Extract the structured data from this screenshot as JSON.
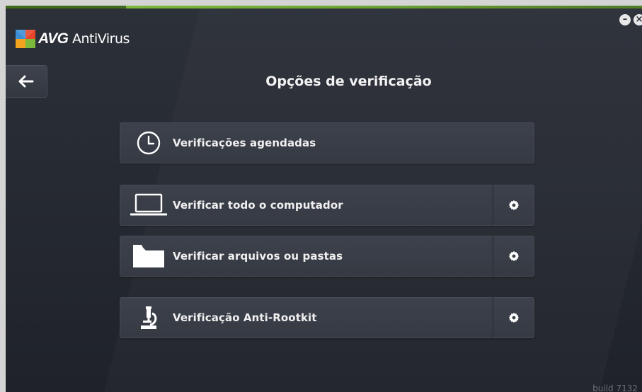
{
  "app": {
    "brand": "AVG",
    "product": "AntiVirus",
    "build_text": "build 7132"
  },
  "window_controls": {
    "minimize_symbol": "–",
    "close_symbol": "×"
  },
  "header": {
    "back_icon": "arrow-left-icon",
    "title": "Opções de verificação"
  },
  "scan_options": [
    {
      "label": "Verificações agendadas",
      "icon": "clock-icon",
      "has_settings": false
    },
    {
      "label": "Verificar todo o computador",
      "icon": "laptop-icon",
      "has_settings": true,
      "settings_icon": "gear-icon"
    },
    {
      "label": "Verificar arquivos ou pastas",
      "icon": "folder-icon",
      "has_settings": true,
      "settings_icon": "gear-icon"
    },
    {
      "label": "Verificação Anti-Rootkit",
      "icon": "microscope-icon",
      "has_settings": true,
      "settings_icon": "gear-icon"
    }
  ],
  "colors": {
    "background": "#262a32",
    "button": "#3a3e47",
    "text": "#f0f0f0",
    "accent_green": "#7cb83a"
  }
}
